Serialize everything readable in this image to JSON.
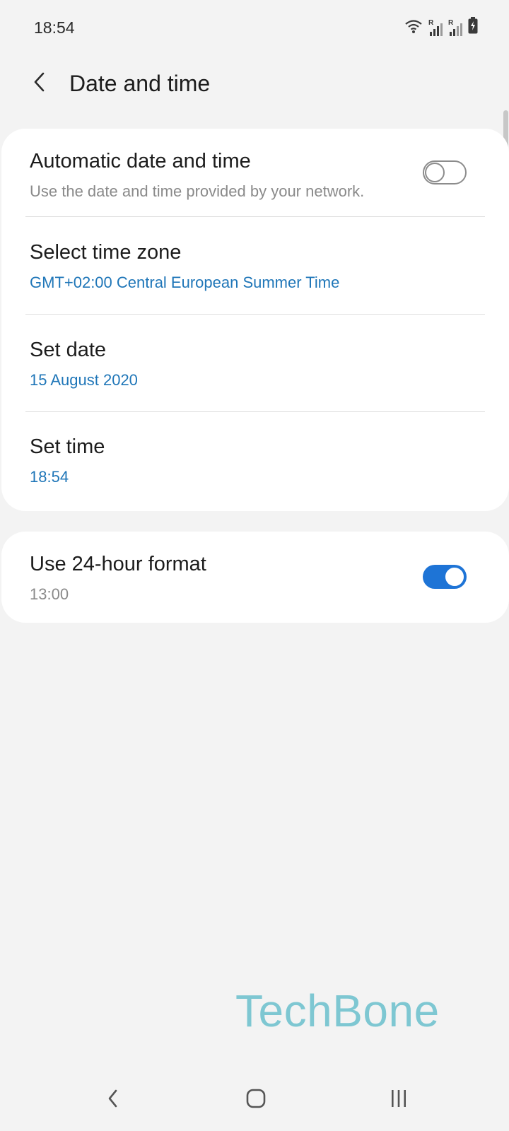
{
  "status_bar": {
    "time": "18:54",
    "icons": [
      "wifi-icon",
      "signal-icon-sim1",
      "signal-icon-sim2",
      "battery-charging-icon"
    ],
    "signal_badge": "R"
  },
  "app_bar": {
    "title": "Date and time",
    "back_icon": "chevron-left-icon"
  },
  "settings_main": [
    {
      "title": "Automatic date and time",
      "subtitle": "Use the date and time provided by your network.",
      "toggle": false
    },
    {
      "title": "Select time zone",
      "subtitle": "GMT+02:00 Central European Summer Time"
    },
    {
      "title": "Set date",
      "subtitle": "15 August 2020"
    },
    {
      "title": "Set time",
      "subtitle": "18:54"
    }
  ],
  "settings_format": {
    "title": "Use 24-hour format",
    "subtitle": "13:00",
    "toggle": true
  },
  "watermark": "TechBone",
  "nav_bar": {
    "icons": [
      "nav-back-icon",
      "nav-home-icon",
      "nav-recents-icon"
    ]
  },
  "colors": {
    "background": "#f3f3f3",
    "card": "#ffffff",
    "accent_blue": "#1f76b8",
    "toggle_on": "#1e74d6",
    "watermark": "#7ec7d2"
  }
}
